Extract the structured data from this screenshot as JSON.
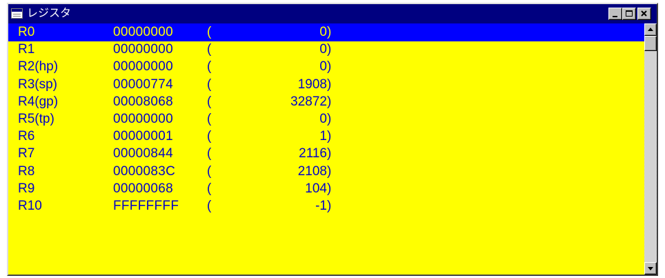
{
  "window": {
    "title": "レジスタ",
    "icon": "window-icon"
  },
  "controls": {
    "minimize_icon": "minimize-icon",
    "maximize_icon": "maximize-icon",
    "close_icon": "close-icon"
  },
  "registers": [
    {
      "name": "R0",
      "hex": "00000000",
      "open": "(",
      "dec": "0",
      "close": ")"
    },
    {
      "name": "R1",
      "hex": "00000000",
      "open": "(",
      "dec": "0",
      "close": ")"
    },
    {
      "name": "R2(hp)",
      "hex": "00000000",
      "open": "(",
      "dec": "0",
      "close": ")"
    },
    {
      "name": "R3(sp)",
      "hex": "00000774",
      "open": "(",
      "dec": "1908",
      "close": ")"
    },
    {
      "name": "R4(gp)",
      "hex": "00008068",
      "open": "(",
      "dec": "32872",
      "close": ")"
    },
    {
      "name": "R5(tp)",
      "hex": "00000000",
      "open": "(",
      "dec": "0",
      "close": ")"
    },
    {
      "name": "R6",
      "hex": "00000001",
      "open": "(",
      "dec": "1",
      "close": ")"
    },
    {
      "name": "R7",
      "hex": "00000844",
      "open": "(",
      "dec": "2116",
      "close": ")"
    },
    {
      "name": "R8",
      "hex": "0000083C",
      "open": "(",
      "dec": "2108",
      "close": ")"
    },
    {
      "name": "R9",
      "hex": "00000068",
      "open": "(",
      "dec": "104",
      "close": ")"
    },
    {
      "name": "R10",
      "hex": "FFFFFFFF",
      "open": "(",
      "dec": "-1",
      "close": ")"
    }
  ],
  "selected_row": 0,
  "scrollbar": {
    "up_icon": "scroll-up-arrow-icon",
    "down_icon": "scroll-down-arrow-icon"
  },
  "colors": {
    "title_bar": "#000080",
    "list_background": "#ffff00",
    "list_text": "#0000c8",
    "selection_background": "#0000ff",
    "selection_text": "#ffff00"
  }
}
